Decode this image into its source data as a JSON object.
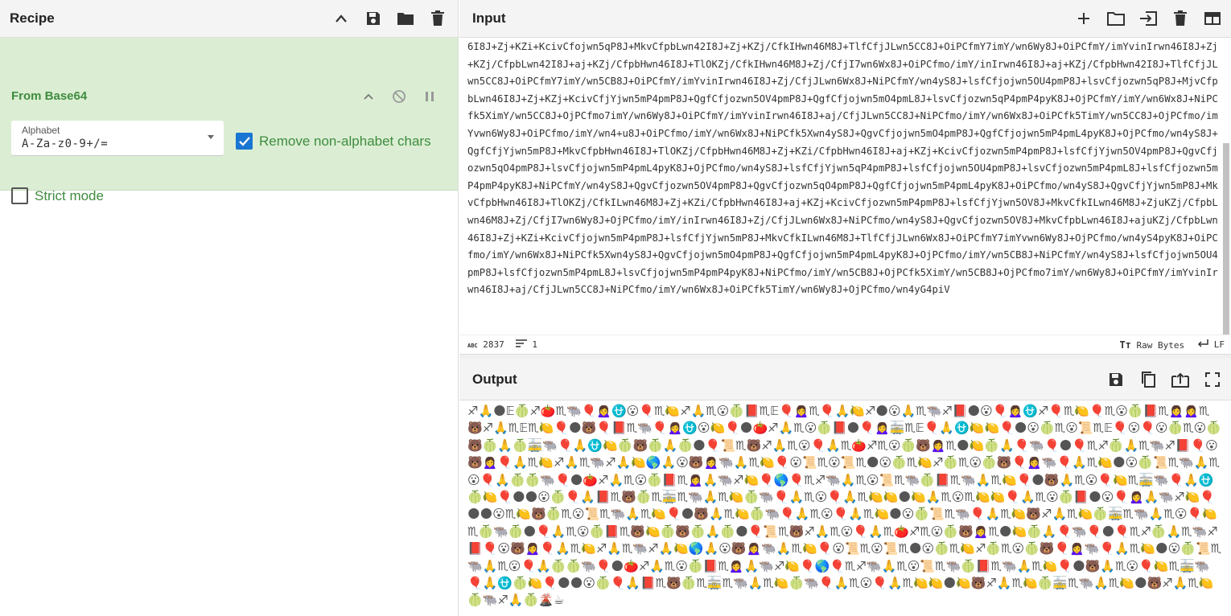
{
  "recipe": {
    "title": "Recipe",
    "operation": {
      "name": "From Base64",
      "alphabet_label": "Alphabet",
      "alphabet_value": "A-Za-z0-9+/=",
      "remove_non_alphabet_label": "Remove non-alphabet chars",
      "remove_non_alphabet_checked": true,
      "strict_mode_label": "Strict mode",
      "strict_mode_checked": false
    }
  },
  "input": {
    "title": "Input",
    "text": "6I8J+Zj+KZi+KcivCfojwn5qP8J+MkvCfpbLwn42I8J+Zj+KZj/CfkIHwn46M8J+TlfCfjJLwn5CC8J+OiPCfmY7imY/wn6Wy8J+OiPCfmY/imYvinIrwn46I8J+Zj+KZj/CfpbLwn42I8J+aj+KZj/CfpbHwn46I8J+TlOKZj/CfkIHwn46M8J+Zj/CfjI7wn6Wx8J+OiPCfmo/imY/inIrwn46I8J+aj+KZj/CfpbHwn42I8J+TlfCfjJLwn5CC8J+OiPCfmY7imY/wn5CB8J+OiPCfmY/imYvinIrwn46I8J+Zj/CfjJLwn6Wx8J+NiPCfmY/wn4yS8J+lsfCfjojwn5OU4pmP8J+lsvCfjozwn5qP8J+MjvCfpbLwn46I8J+Zj+KZj+KcivCfjYjwn5mP4pmP8J+QgfCfjozwn5OV4pmP8J+QgfCfjojwn5mO4pmL8J+lsvCfjozwn5qP4pmP4pyK8J+OjPCfmY/imY/wn6Wx8J+NiPCfk5XimY/wn5CC8J+OjPCfmo7imY/wn6Wy8J+OiPCfmY/imYvinIrwn46I8J+aj/CfjJLwn5CC8J+NiPCfmo/imY/wn6Wx8J+OiPCfk5TimY/wn5CC8J+OjPCfmo/imYvwn6Wy8J+OiPCfmo/imY/wn4+u8J+OiPCfmo/imY/wn6Wx8J+NiPCfk5Xwn4yS8J+QgvCfjojwn5mO4pmP8J+QgfCfjojwn5mP4pmL4pyK8J+OjPCfmo/wn4yS8J+QgfCfjYjwn5mP8J+MkvCfpbHwn46I8J+TlOKZj/CfpbHwn46M8J+Zj+KZi/CfpbHwn46I8J+aj+KZj+KcivCfjozwn5mP4pmP8J+lsfCfjYjwn5OV4pmP8J+QgvCfjozwn5qO4pmP8J+lsvCfjojwn5mP4pmL4pyK8J+OjPCfmo/wn4yS8J+lsfCfjYjwn5qP4pmP8J+lsfCfjojwn5OU4pmP8J+lsvCfjozwn5mP4pmL8J+lsfCfjozwn5mP4pmP4pyK8J+NiPCfmY/wn4yS8J+QgvCfjozwn5OV4pmP8J+QgvCfjozwn5qO4pmP8J+QgfCfjojwn5mP4pmL4pyK8J+OiPCfmo/wn4yS8J+QgvCfjYjwn5mP8J+MkvCfpbHwn46I8J+TlOKZj/CfkILwn46M8J+Zj+KZi/CfpbHwn46I8J+aj+KZj+KcivCfjozwn5mP4pmP8J+lsfCfjYjwn5OV8J+MkvCfkILwn46M8J+ZjuKZj/CfpbLwn46M8J+Zj/CfjI7wn6Wy8J+OjPCfmo/imY/inIrwn46I8J+Zj/CfjJLwn6Wx8J+NiPCfmo/wn4yS8J+QgvCfjozwn5OV8J+MkvCfpbLwn46I8J+ajuKZj/CfpbLwn46I8J+Zj+KZi+KcivCfjojwn5mP4pmP8J+lsfCfjYjwn5mP8J+MkvCfkILwn46M8J+TlfCfjJLwn6Wx8J+OiPCfmY7imYvwn6Wy8J+OjPCfmo/wn4yS4pyK8J+OiPCfmo/imY/wn6Wx8J+NiPCfk5Xwn4yS8J+QgvCfjojwn5mO4pmP8J+QgfCfjojwn5mP4pmL4pyK8J+OjPCfmo/imY/wn5CB8J+NiPCfmY/wn4yS8J+lsfCfjojwn5OU4pmP8J+lsfCfjozwn5mP4pmL8J+lsvCfjojwn5mP4pmP4pyK8J+NiPCfmo/imY/wn5CB8J+OjPCfk5XimY/wn5CB8J+OjPCfmo7imY/wn6Wy8J+OiPCfmY/imYvinIrwn46I8J+aj/CfjJLwn5CC8J+NiPCfmo/imY/wn6Wx8J+OiPCfk5TimY/wn6Wy8J+OjPCfmo/wn4yG4piV ",
    "status_chars_label": "ABC",
    "status_chars": "2837",
    "status_lines": "1",
    "status_encoding": "Raw Bytes",
    "status_eol": "LF"
  },
  "output": {
    "title": "Output",
    "text": "♐🙏🌑𝔼🍈♐🍅♏🐃🎈🙍‍♀️⛎😮🎈♏🍋♐🙏♏😮🍈📕♏𝔼🎈🙍‍♀️♏🎈🙏🍋♐🌑😮🙏♏🐃♐📕🌑😮🎈🙍‍♀️⛎♐🎈♏🍋🎈♏😮🍈📕♏🙍‍♀️🙍‍♀️♏🐻♐🙏♏𝔼♏🍋🎈🌑🐻🎈📕♏🐃🎈🙍‍♀️⛎😮🍋🎈🌑🍅♐🙏♏😮🍈📕🌑🎈🙍‍♀️🚋♏𝔼🎈🙏⛎🍋🍋🎈🌑😮🍈♏😮📜♏𝔼🎈😮🎈😮🍈♏😮🍈🐻🍈🙏🍈🚋🐃🎈🙏⛎🍋🍈🐻🍈🙏🍈🌑🎈📜♏🐻♐🙏♏😮🎈🙏♏🍅♐♏😮🍈🐻🙍‍♀️♏🌑🍋🍈🙏🎈🐃🎈🌑🎈♏♐🍈🙏♏🐃♐📕🎈😮🐻🙍‍♀️🎈🙏♏🍋♐🙏♏🐃♐🙏🍋🌎🙏😮🐻🙍‍♀️🐃🙏♏🍋🎈😮📜♏😮📜♏🌑😮🍈♏🍋♐🍈♏😮🍈🐻🎈🙍‍♀️🐃🎈🙏♏🍋🌑😮🍈📜♏🐃🙏♏😮🎈🙏🍈🍈🐃🎈🌑🍅♐🙏♏😮🍈📕♏🙍‍♀️🙏🐃♐🍋🎈🌎🎈♏♐🐃🙏♏😮📜♏🐃🍈📕♏🐃🙏♏🍋🎈🌑🐻🙏♏😮🎈🍋♏🚋🐃🎈🙏⛎🍈🍋🎈🌑🌑😮🍈🎈🙏📕♏🐻🍈♏🚋♏🐃🙏♏🍋🍈🐃🎈🙏♏😮🎈🙏♏🍋🍋🌑🍋🙏♏😮♏🍋🍋🎈🙏♏😮🍈📕🌑😮🎈🙍‍♀️🙏🐃♐🍋🎈🌑🌑😮♏🍋🐻🍈♏😮📜♏🐃🙏♏🍋🎈🌑🐻🙏♏🍋🍈🐃🎈🙏♏😮🎈🙏♏🍋🌑😮🍈📜♏🐃🎈🙏♏🍋🐻♐🙏♏🍋🍈🚋♏🐃🙏♏😮🎈🍋♏🍈🐃🍈🌑🎈🙏♏😮🍈📕♏🐻🍋🍈🐻🍈🙏🍈🌑🎈📜♏🐻♐🙏♏😮🎈🙏♏🍅♐♏😮🍈🐻🙍‍♀️♏🌑🍋🍈🙏🎈🐃🎈🌑🎈♏♐🍈🙏♏🐃♐📕🎈😮🐻🙍‍♀️🎈🙏♏🍋♐🙏♏🐃♐🙏🍋🌎🙏😮🐻🙍‍♀️🐃🙏♏🍋🎈😮📜♏😮📜♏🌑😮🍈♏🍋♐🍈♏😮🍈🐻🎈🙍‍♀️🐃🎈🙏♏🍋🌑😮🍈📜♏🐃🙏♏😮🎈🙏🍈🍈🐃🎈🌑🍅♐🙏♏😮🍈📕♏🙍‍♀️🙏🐃♐🍋🎈🌎🎈♏♐🐃🙏♏😮📜♏🐃🍈📕♏🐃🙏♏🍋🎈🌑🐻🙏♏😮🎈🍋♏🚋🐃🎈🙏⛎🍈🍋🎈🌑🌑😮🍈🎈🙏📕♏🐻🍈♏🚋♏🐃🙏♏🍋🍈🐃🎈🙏♏😮🎈🙏♏🍋🍋🌑🍋🐻♐🙏♏🍋🍈🚋♏🐃🙏♏🍋🌑🐻♐🙏♏🍋🍈🐃♐🙏🍈🌋☕"
  },
  "colors": {
    "op_bg": "#dbeed3",
    "op_title": "#3f8c3f",
    "checkbox_on": "#1976d2"
  },
  "icons": {
    "recipe_header": [
      "chevron-up-icon",
      "save-icon",
      "folder-icon",
      "trash-icon"
    ],
    "op_controls": [
      "chevron-up-icon",
      "disable-icon",
      "pause-icon"
    ],
    "input_header": [
      "plus-icon",
      "folder-icon",
      "import-icon",
      "trash-icon",
      "layout-icon"
    ],
    "output_header": [
      "save-icon",
      "copy-icon",
      "replace-input-icon",
      "fullscreen-icon"
    ]
  }
}
